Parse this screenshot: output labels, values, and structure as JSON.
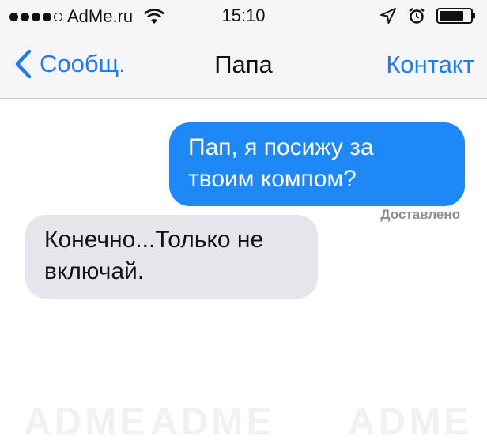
{
  "status_bar": {
    "carrier": "AdMe.ru",
    "time": "15:10"
  },
  "nav": {
    "back_label": "Сообщ.",
    "title": "Папа",
    "contact_label": "Контакт"
  },
  "watermark_text": "ADME",
  "messages": [
    {
      "direction": "outgoing",
      "text": "Пап, я посижу за твоим компом?"
    },
    {
      "direction": "incoming",
      "text": "Конечно...Только не включай."
    }
  ],
  "delivery_status": "Доставлено",
  "colors": {
    "outgoing_bubble": "#1e88f6",
    "incoming_bubble": "#e6e5ec",
    "accent": "#1d7af3"
  }
}
